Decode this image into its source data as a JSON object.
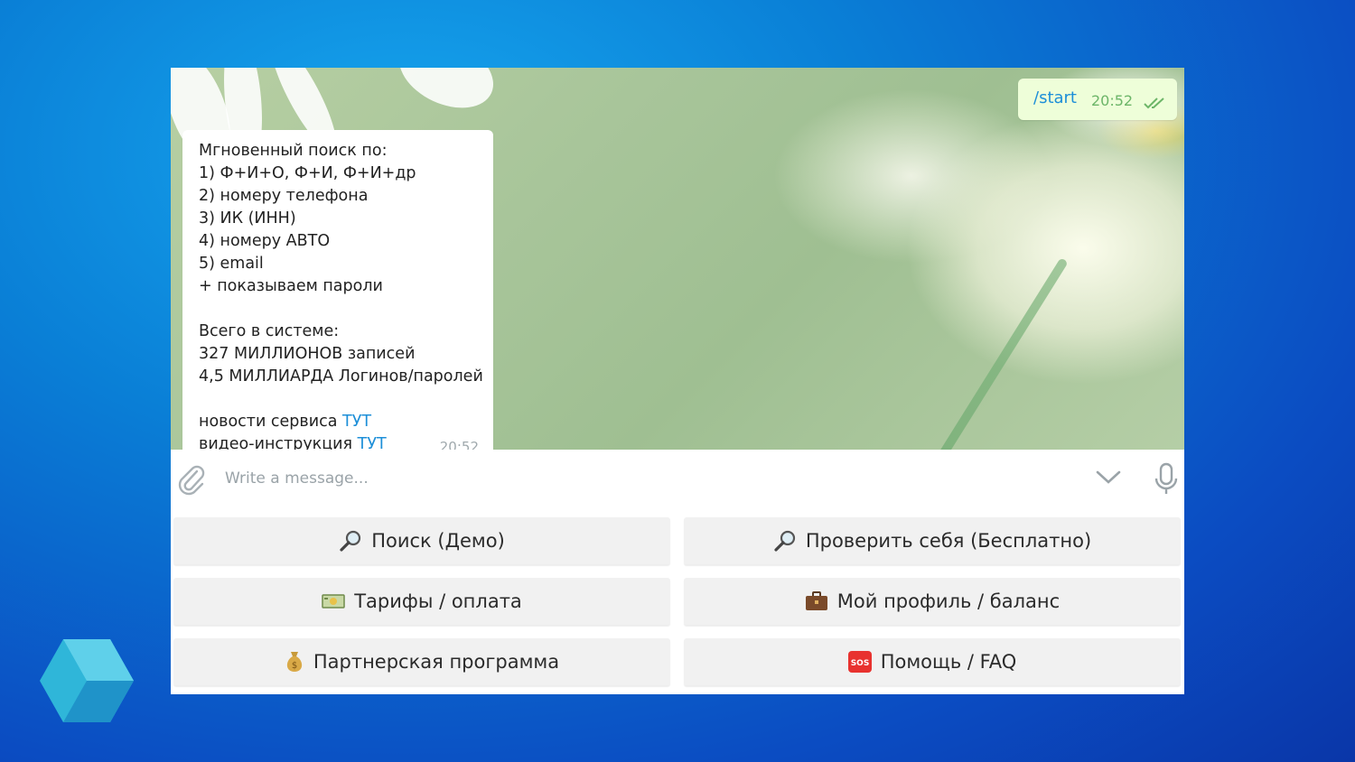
{
  "chat": {
    "incoming": {
      "lines": [
        "Мгновенный поиск по:",
        "1) Ф+И+О, Ф+И, Ф+И+др",
        "2) номеру телефона",
        "3) ИК (ИНН)",
        "4) номеру АВТО",
        "5) email",
        "+ показываем пароли",
        "",
        "Всего в системе:",
        "327 МИЛЛИОНОВ записей",
        "4,5 МИЛЛИАРДА Логинов/паролей",
        "",
        "новости сервиса"
      ],
      "news_link": "ТУТ",
      "video_label": "видео-инструкция",
      "video_link": "ТУТ",
      "time": "20:52"
    },
    "outgoing": {
      "text": "/start",
      "time": "20:52"
    }
  },
  "input": {
    "placeholder": "Write a message..."
  },
  "keyboard": {
    "buttons": [
      {
        "label": "Поиск (Демо)",
        "icon": "magnifier-icon"
      },
      {
        "label": "Проверить себя (Бесплатно)",
        "icon": "magnifier-icon"
      },
      {
        "label": "Тарифы / оплата",
        "icon": "banknote-icon"
      },
      {
        "label": "Мой профиль / баланс",
        "icon": "briefcase-icon"
      },
      {
        "label": "Партнерская программа",
        "icon": "money-bag-icon"
      },
      {
        "label": "Помощь / FAQ",
        "icon": "sos-icon"
      }
    ]
  },
  "colors": {
    "link": "#1d8fd8",
    "outgoing_bubble": "#eefed9",
    "check": "#6cb568"
  }
}
